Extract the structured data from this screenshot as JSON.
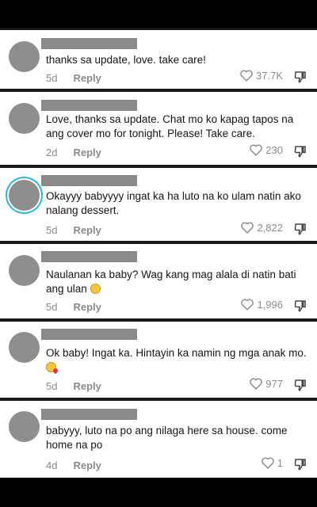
{
  "comments": [
    {
      "text": "thanks sa update, love. take care!",
      "time": "5d",
      "reply": "Reply",
      "likes": "37.7K",
      "ring": false,
      "emoji": ""
    },
    {
      "text": "Love, thanks sa update. Chat mo ko kapag tapos na ang cover mo for tonight. Please! Take care.",
      "time": "2d",
      "reply": "Reply",
      "likes": "230",
      "ring": false,
      "emoji": ""
    },
    {
      "text": "Okayyy babyyyy ingat ka ha luto na ko ulam natin ako nalang dessert.",
      "time": "5d",
      "reply": "Reply",
      "likes": "2,822",
      "ring": true,
      "emoji": ""
    },
    {
      "text": "Naulanan ka baby? Wag kang mag alala di natin bati ang ulan",
      "time": "5d",
      "reply": "Reply",
      "likes": "1,996",
      "ring": false,
      "emoji": "worried-face"
    },
    {
      "text": "Ok baby! Ingat ka. Hintayin ka namin ng mga anak mo.",
      "time": "5d",
      "reply": "Reply",
      "likes": "977",
      "ring": false,
      "emoji": "face-blowing-kiss"
    },
    {
      "text": "babyyy, luto na po ang nilaga here sa house. come home na po",
      "time": "4d",
      "reply": "Reply",
      "likes": "1",
      "ring": false,
      "emoji": ""
    }
  ],
  "icons": {
    "like": "heart-outline-icon",
    "dislike": "thumbs-down-icon"
  }
}
